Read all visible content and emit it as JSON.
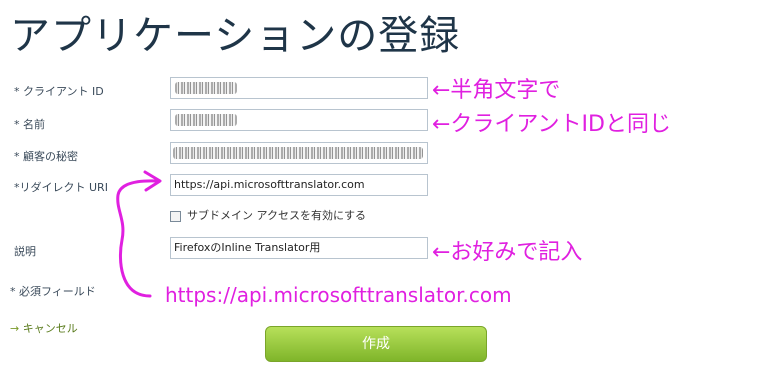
{
  "page": {
    "title": "アプリケーションの登録"
  },
  "form": {
    "client_id_label": "* クライアント ID",
    "name_label": "* 名前",
    "secret_label": "* 顧客の秘密",
    "redirect_label": "*リダイレクト URI",
    "redirect_value": "https://api.microsofttranslator.com",
    "subdomain_label": "サブドメイン アクセスを有効にする",
    "description_label": "説明",
    "description_value": "FirefoxのInline Translator用",
    "required_label": "* 必須フィールド",
    "cancel_label": "キャンセル",
    "create_label": "作成"
  },
  "annotations": {
    "client_id_note": "←半角文字で",
    "name_note": "←クライアントIDと同じ",
    "description_note": "←お好みで記入",
    "redirect_note": "https://api.microsofttranslator.com",
    "color": "#e020e0"
  }
}
